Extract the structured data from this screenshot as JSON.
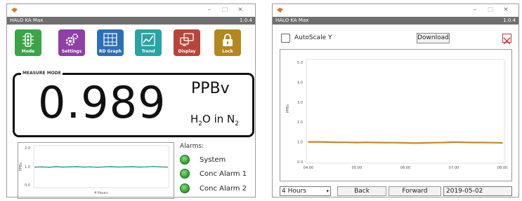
{
  "window1": {
    "title": "HALO KA Max",
    "version": "1.0.4",
    "controls": {
      "minimize": "–",
      "maximize": "□",
      "close": "×"
    },
    "tiles": [
      {
        "label": "Mode",
        "icon": "traffic-light-icon",
        "color": "#3aa447"
      },
      {
        "label": "Settings",
        "icon": "gears-icon",
        "color": "#8e3fa8"
      },
      {
        "label": "RD Graph",
        "icon": "grid-icon",
        "color": "#2b6fb6"
      },
      {
        "label": "Trend",
        "icon": "trend-icon",
        "color": "#2aa3a3"
      },
      {
        "label": "Display",
        "icon": "display-icon",
        "color": "#b8453a"
      },
      {
        "label": "Lock",
        "icon": "lock-icon",
        "color": "#b5871f"
      }
    ],
    "measure_label": "MEASURE MODE",
    "value": "0.989",
    "unit": "PPBv",
    "species": {
      "a": "H",
      "a_sub": "2",
      "b": "O in N",
      "b_sub": "2"
    },
    "mini_chart": {
      "ylabel": "PPBv",
      "yticks": [
        "2.0",
        "1.0",
        "0.0"
      ],
      "xlabel": "4 Hours"
    },
    "alarms_title": "Alarms:",
    "alarms": [
      "System",
      "Conc Alarm 1",
      "Conc Alarm 2"
    ],
    "alarm_color": "#3fae3f"
  },
  "window2": {
    "title": "HALO KA Max",
    "version": "1.0.4",
    "controls": {
      "minimize": "–",
      "maximize": "□",
      "close": "×"
    },
    "autoscale_label": "AutoScale Y",
    "download_label": "Download",
    "period_value": "4 Hours",
    "back_label": "Back",
    "forward_label": "Forward",
    "date_value": "2019-05-02",
    "line_color": "#c8862b"
  },
  "chart_data": [
    {
      "type": "line",
      "ylabel": "PPBv",
      "yticks": [
        "2.0",
        "1.0",
        "0.0"
      ],
      "xlabel": "4 Hours",
      "ylim": [
        0,
        2
      ],
      "series": [
        {
          "values": [
            0.98,
            0.99,
            0.97,
            1.0,
            0.98,
            0.99,
            1.0,
            0.98,
            0.99,
            0.97,
            0.99,
            1.0,
            0.98,
            0.99,
            1.0,
            0.98,
            0.99,
            1.01,
            0.99,
            0.98
          ]
        }
      ]
    },
    {
      "type": "line",
      "ylabel": "PPBv",
      "yticks": [
        "5.0",
        "4.0",
        "3.0",
        "2.0",
        "1.0",
        "0.0"
      ],
      "xticks": [
        "04:00",
        "05:00",
        "06:00",
        "07:00",
        "08:00"
      ],
      "ylim": [
        0,
        5
      ],
      "grid": false,
      "series": [
        {
          "x": [
            4.0,
            4.2,
            4.4,
            4.6,
            4.8,
            5.0,
            5.2,
            5.4,
            5.6,
            5.8,
            6.0,
            6.2,
            6.4,
            6.6,
            6.8,
            7.0,
            7.2,
            7.4,
            7.6,
            7.8,
            8.0
          ],
          "values": [
            1.0,
            1.0,
            0.99,
            0.98,
            0.98,
            0.97,
            0.98,
            0.97,
            0.96,
            0.96,
            0.95,
            0.94,
            0.95,
            0.96,
            0.97,
            0.99,
            0.98,
            0.97,
            0.97,
            0.96,
            0.95
          ]
        }
      ]
    }
  ]
}
